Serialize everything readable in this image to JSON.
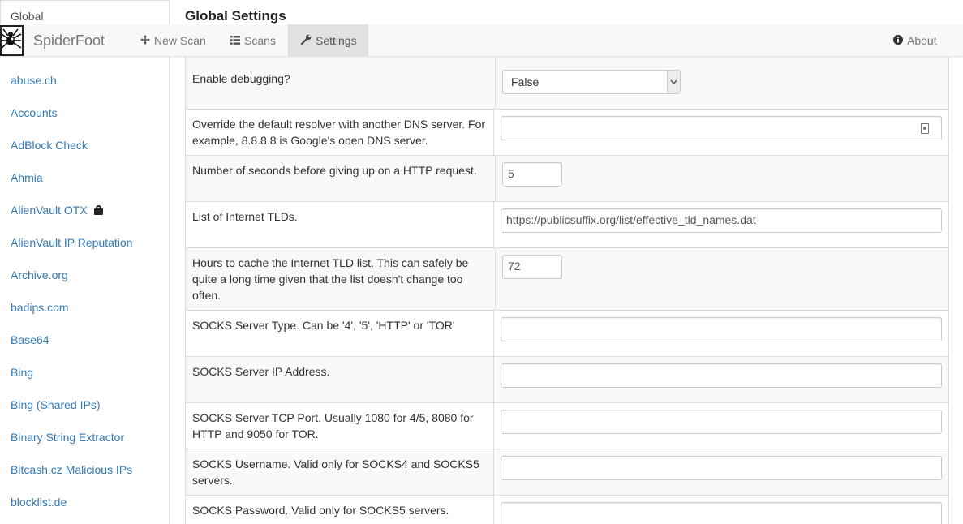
{
  "sidebar": {
    "global_label": "Global",
    "items": [
      {
        "label": "abuse.ch"
      },
      {
        "label": "Accounts"
      },
      {
        "label": "AdBlock Check"
      },
      {
        "label": "Ahmia"
      },
      {
        "label": "AlienVault OTX",
        "icon": "lock-icon"
      },
      {
        "label": "AlienVault IP Reputation"
      },
      {
        "label": "Archive.org"
      },
      {
        "label": "badips.com"
      },
      {
        "label": "Base64"
      },
      {
        "label": "Bing"
      },
      {
        "label": "Bing (Shared IPs)"
      },
      {
        "label": "Binary String Extractor"
      },
      {
        "label": "Bitcash.cz Malicious IPs"
      },
      {
        "label": "blocklist.de"
      }
    ]
  },
  "page": {
    "title": "Global Settings"
  },
  "navbar": {
    "brand": "SpiderFoot",
    "new_scan": "New Scan",
    "scans": "Scans",
    "settings": "Settings",
    "about": "About"
  },
  "settings": [
    {
      "label": "Enable debugging?",
      "type": "select",
      "value": "False"
    },
    {
      "label": "Override the default resolver with another DNS server. For example, 8.8.8.8 is Google's open DNS server.",
      "type": "text",
      "value": ""
    },
    {
      "label": "Number of seconds before giving up on a HTTP request.",
      "type": "short",
      "value": "5"
    },
    {
      "label": "List of Internet TLDs.",
      "type": "text",
      "value": "https://publicsuffix.org/list/effective_tld_names.dat"
    },
    {
      "label": "Hours to cache the Internet TLD list. This can safely be quite a long time given that the list doesn't change too often.",
      "type": "short",
      "value": "72"
    },
    {
      "label": "SOCKS Server Type. Can be '4', '5', 'HTTP' or 'TOR'",
      "type": "text",
      "value": ""
    },
    {
      "label": "SOCKS Server IP Address.",
      "type": "text",
      "value": ""
    },
    {
      "label": "SOCKS Server TCP Port. Usually 1080 for 4/5, 8080 for HTTP and 9050 for TOR.",
      "type": "text",
      "value": ""
    },
    {
      "label": "SOCKS Username. Valid only for SOCKS4 and SOCKS5 servers.",
      "type": "text",
      "value": ""
    },
    {
      "label": "SOCKS Password. Valid only for SOCKS5 servers.",
      "type": "text",
      "value": ""
    }
  ],
  "colors": {
    "link": "#337ab7",
    "navbar_bg": "#f8f8f8",
    "active_tab": "#e2e2e2"
  }
}
